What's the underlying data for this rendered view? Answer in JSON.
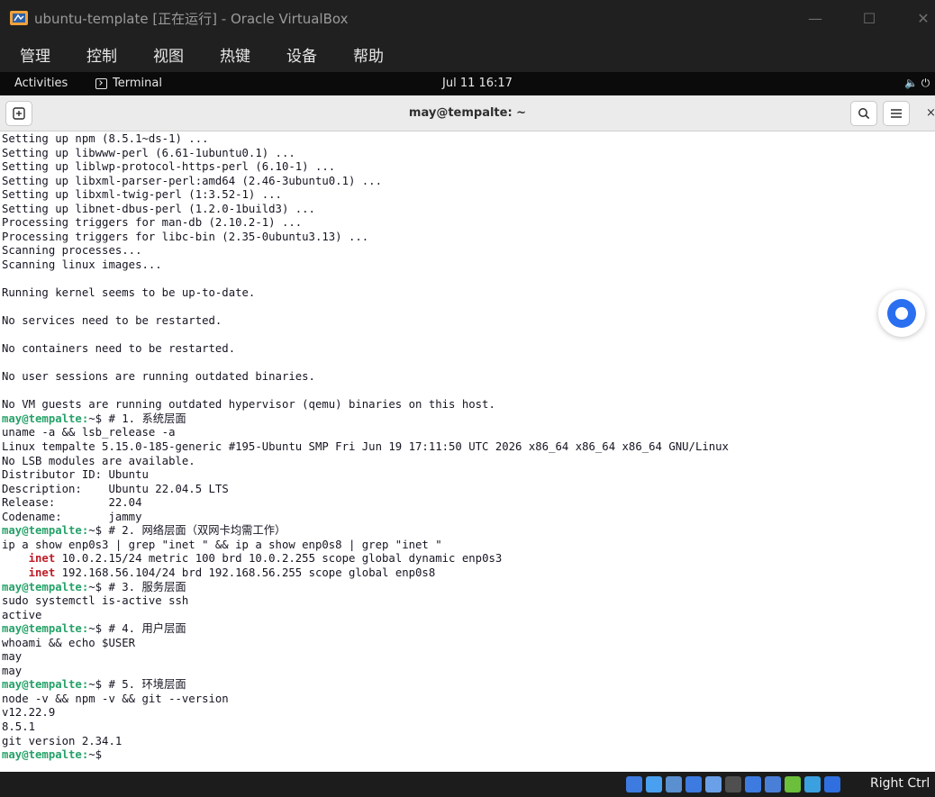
{
  "window": {
    "title": "ubuntu-template [正在运行] - Oracle VirtualBox",
    "minimize_glyph": "—",
    "maximize_glyph": "☐",
    "close_glyph": "✕"
  },
  "menubar": {
    "items": [
      "管理",
      "控制",
      "视图",
      "热键",
      "设备",
      "帮助"
    ]
  },
  "gnome": {
    "activities": "Activities",
    "app_label": "Terminal",
    "clock": "Jul 11 16:17",
    "tray": "🔈 ⏻"
  },
  "terminal": {
    "title": "may@tempalte: ~",
    "new_tab_glyph": "⊞",
    "search_glyph": "⌕",
    "menu_glyph": "☰",
    "close_glyph": "×",
    "lines": [
      [
        {
          "t": "Setting up npm (8.5.1~ds-1) ..."
        }
      ],
      [
        {
          "t": "Setting up libwww-perl (6.61-1ubuntu0.1) ..."
        }
      ],
      [
        {
          "t": "Setting up liblwp-protocol-https-perl (6.10-1) ..."
        }
      ],
      [
        {
          "t": "Setting up libxml-parser-perl:amd64 (2.46-3ubuntu0.1) ..."
        }
      ],
      [
        {
          "t": "Setting up libxml-twig-perl (1:3.52-1) ..."
        }
      ],
      [
        {
          "t": "Setting up libnet-dbus-perl (1.2.0-1build3) ..."
        }
      ],
      [
        {
          "t": "Processing triggers for man-db (2.10.2-1) ..."
        }
      ],
      [
        {
          "t": "Processing triggers for libc-bin (2.35-0ubuntu3.13) ..."
        }
      ],
      [
        {
          "t": "Scanning processes..."
        }
      ],
      [
        {
          "t": "Scanning linux images..."
        }
      ],
      [
        {
          "t": ""
        }
      ],
      [
        {
          "t": "Running kernel seems to be up-to-date."
        }
      ],
      [
        {
          "t": ""
        }
      ],
      [
        {
          "t": "No services need to be restarted."
        }
      ],
      [
        {
          "t": ""
        }
      ],
      [
        {
          "t": "No containers need to be restarted."
        }
      ],
      [
        {
          "t": ""
        }
      ],
      [
        {
          "t": "No user sessions are running outdated binaries."
        }
      ],
      [
        {
          "t": ""
        }
      ],
      [
        {
          "t": "No VM guests are running outdated hypervisor (qemu) binaries on this host."
        }
      ],
      [
        {
          "t": "may@tempalte:",
          "c": "prompt"
        },
        {
          "t": "~$ # 1. 系统层面"
        }
      ],
      [
        {
          "t": "uname -a && lsb_release -a"
        }
      ],
      [
        {
          "t": "Linux tempalte 5.15.0-185-generic #195-Ubuntu SMP Fri Jun 19 17:11:50 UTC 2026 x86_64 x86_64 x86_64 GNU/Linux"
        }
      ],
      [
        {
          "t": "No LSB modules are available."
        }
      ],
      [
        {
          "t": "Distributor ID:\tUbuntu"
        }
      ],
      [
        {
          "t": "Description:\tUbuntu 22.04.5 LTS"
        }
      ],
      [
        {
          "t": "Release:\t22.04"
        }
      ],
      [
        {
          "t": "Codename:\tjammy"
        }
      ],
      [
        {
          "t": "may@tempalte:",
          "c": "prompt"
        },
        {
          "t": "~$ # 2. 网络层面（双网卡均需工作）"
        }
      ],
      [
        {
          "t": "ip a show enp0s3 | grep \"inet \" && ip a show enp0s8 | grep \"inet \""
        }
      ],
      [
        {
          "t": "    "
        },
        {
          "t": "inet",
          "c": "hl"
        },
        {
          "t": " 10.0.2.15/24 metric 100 brd 10.0.2.255 scope global dynamic enp0s3"
        }
      ],
      [
        {
          "t": "    "
        },
        {
          "t": "inet",
          "c": "hl"
        },
        {
          "t": " 192.168.56.104/24 brd 192.168.56.255 scope global enp0s8"
        }
      ],
      [
        {
          "t": "may@tempalte:",
          "c": "prompt"
        },
        {
          "t": "~$ # 3. 服务层面"
        }
      ],
      [
        {
          "t": "sudo systemctl is-active ssh"
        }
      ],
      [
        {
          "t": "active"
        }
      ],
      [
        {
          "t": "may@tempalte:",
          "c": "prompt"
        },
        {
          "t": "~$ # 4. 用户层面"
        }
      ],
      [
        {
          "t": "whoami && echo $USER"
        }
      ],
      [
        {
          "t": "may"
        }
      ],
      [
        {
          "t": "may"
        }
      ],
      [
        {
          "t": "may@tempalte:",
          "c": "prompt"
        },
        {
          "t": "~$ # 5. 环境层面"
        }
      ],
      [
        {
          "t": "node -v && npm -v && git --version"
        }
      ],
      [
        {
          "t": "v12.22.9"
        }
      ],
      [
        {
          "t": "8.5.1"
        }
      ],
      [
        {
          "t": "git version 2.34.1"
        }
      ],
      [
        {
          "t": "may@tempalte:",
          "c": "prompt"
        },
        {
          "t": "~$ "
        }
      ]
    ]
  },
  "statusbar": {
    "host_key": "Right Ctrl",
    "icons": [
      {
        "name": "hard-disk-icon",
        "color": "#3d7be0"
      },
      {
        "name": "optical-drive-icon",
        "color": "#4aa0f0"
      },
      {
        "name": "audio-icon",
        "color": "#5a8fd0"
      },
      {
        "name": "network-icon",
        "color": "#3d7be0"
      },
      {
        "name": "usb-icon",
        "color": "#6aa0e8"
      },
      {
        "name": "shared-folders-icon",
        "color": "#4f4f4f"
      },
      {
        "name": "display-icon",
        "color": "#3d7be0"
      },
      {
        "name": "recording-icon",
        "color": "#4a7fd8"
      },
      {
        "name": "cpu-activity-icon",
        "color": "#6bbf3b"
      },
      {
        "name": "mouse-integration-icon",
        "color": "#3aa0e0"
      },
      {
        "name": "keyboard-capture-icon",
        "color": "#2f6fe0"
      }
    ]
  },
  "colors": {
    "prompt": "#26a269",
    "highlight": "#c01c28",
    "terminal_bg": "#ffffff",
    "vbox_chrome": "#202020"
  }
}
